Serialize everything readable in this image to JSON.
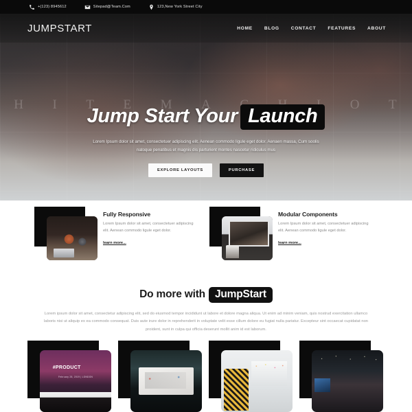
{
  "topbar": {
    "items": [
      {
        "icon": "phone-icon",
        "text": "+(123) 8945612"
      },
      {
        "icon": "envelope-icon",
        "text": "Sitepad@Team.Com"
      },
      {
        "icon": "map-pin-icon",
        "text": "123,New York Street City"
      }
    ]
  },
  "header": {
    "logo": "JUMPSTART",
    "nav": [
      {
        "label": "HOME"
      },
      {
        "label": "BLOG"
      },
      {
        "label": "CONTACT"
      },
      {
        "label": "FEATURES"
      },
      {
        "label": "ABOUT"
      }
    ]
  },
  "hero": {
    "mural_letters": [
      "H",
      "I",
      "T",
      "E",
      "M",
      "A",
      "C",
      "H",
      "I",
      "O",
      "T"
    ],
    "headline_plain": "Jump Start Your",
    "headline_highlight": "Launch",
    "subtext": "Lorem Ipsum dolor sit amet, consectetuer adipiscing elit. Aenean commodo ligule eget dolor. Aenaen massa, Cum soolis natoque penatibus et magnis dis parturient montes nascetur ridiculus mus",
    "primary_button": "EXPLORE LAYOUTS",
    "secondary_button": "PURCHASE"
  },
  "features": [
    {
      "image": "cafe-laptop-photo",
      "title": "Fully Responsive",
      "body": "Lorem Ipsum dolor sit amet, consectetuer adipiscing elit. Aenean commodo ligule eget dolor.",
      "link": "learn more..."
    },
    {
      "image": "presentation-screen-photo",
      "title": "Modular Components",
      "body": "Lorem Ipsum dolor sit amet, consectetuer adipiscing elit. Aenean commodo ligule eget dolor.",
      "link": "learn more..."
    }
  ],
  "domore": {
    "title_plain": "Do more with",
    "title_highlight": "JumpStart",
    "body": "Lorem ipsum dolor sit amet, consectetur adipiscing elit, sed do eiusmod tempor incididunt ut labore et dolore magna aliqua. Ut enim ad minim veniam, quis nostrud exercitation ullamco laboris nisi ut aliquip ex ea commodo consequat. Duis aute irure dolor in reprehenderit in voluptate velit esse cillum dolore eu fugiat nulla pariatur. Excepteur sint occaecat cupidatat non proident, sunt in culpa qui officia deserunt mollit anim id est laborum."
  },
  "gallery": {
    "items": [
      {
        "name": "conference-stage-photo",
        "caption": "#PRODUCT",
        "subcaption": "February 28, 2019   |   LONDON"
      },
      {
        "name": "auditorium-screen-photo",
        "caption": "",
        "subcaption": ""
      },
      {
        "name": "workshop-whiteboard-photo",
        "caption": "",
        "subcaption": ""
      },
      {
        "name": "event-hall-photo",
        "caption": "",
        "subcaption": ""
      }
    ]
  },
  "colors": {
    "dark": "#0b0b0b",
    "light": "#ffffff",
    "muted_text": "#9a9a9a"
  }
}
